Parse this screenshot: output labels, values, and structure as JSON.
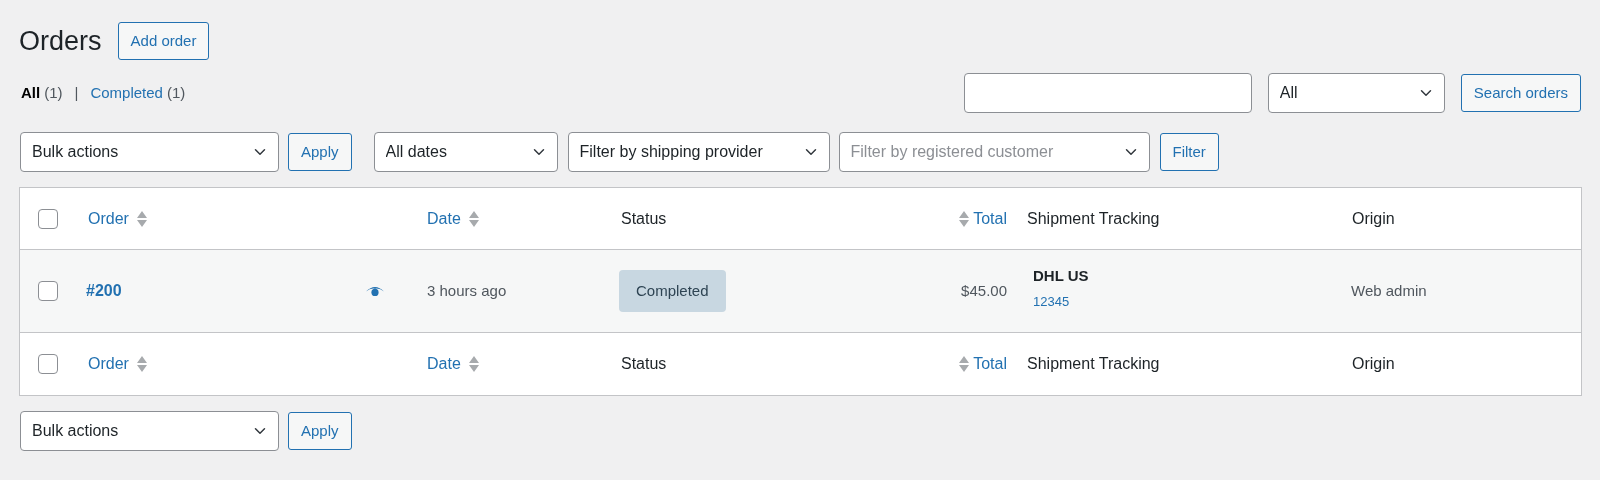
{
  "page": {
    "title": "Orders",
    "add_button": "Add order"
  },
  "views": [
    {
      "label": "All",
      "count": "(1)",
      "selected": true
    },
    {
      "label": "Completed",
      "count": "(1)",
      "selected": false
    }
  ],
  "views_separator": "|",
  "search": {
    "type_select": "All",
    "button": "Search orders"
  },
  "top_actions": {
    "bulk_select": "Bulk actions",
    "apply_button": "Apply",
    "date_select": "All dates",
    "shipping_select": "Filter by shipping provider",
    "customer_placeholder": "Filter by registered customer",
    "filter_button": "Filter"
  },
  "table": {
    "header": [
      {
        "kind": "check",
        "checked": false
      },
      {
        "kind": "order",
        "label": "Order",
        "sortable": true
      },
      {
        "kind": "blank"
      },
      {
        "kind": "date",
        "label": "Date",
        "sortable": true
      },
      {
        "kind": "status",
        "label": "Status",
        "sortable": false
      },
      {
        "kind": "total",
        "label": "Total",
        "sortable": true
      },
      {
        "kind": "tracking",
        "label": "Shipment Tracking",
        "sortable": false
      },
      {
        "kind": "origin",
        "label": "Origin",
        "sortable": false
      }
    ],
    "rows": [
      {
        "checked": false,
        "order": "#200",
        "date": "3 hours ago",
        "status": "Completed",
        "total": "$45.00",
        "carrier": "DHL US",
        "tracking_number": "12345",
        "origin": "Web admin"
      }
    ],
    "footer": [
      {
        "kind": "check",
        "checked": false
      },
      {
        "kind": "order",
        "label": "Order",
        "sortable": true
      },
      {
        "kind": "blank"
      },
      {
        "kind": "date",
        "label": "Date",
        "sortable": true
      },
      {
        "kind": "status",
        "label": "Status",
        "sortable": false
      },
      {
        "kind": "total",
        "label": "Total",
        "sortable": true
      },
      {
        "kind": "tracking",
        "label": "Shipment Tracking",
        "sortable": false
      },
      {
        "kind": "origin",
        "label": "Origin",
        "sortable": false
      }
    ]
  },
  "bottom_actions": {
    "bulk_select": "Bulk actions",
    "apply_button": "Apply"
  }
}
